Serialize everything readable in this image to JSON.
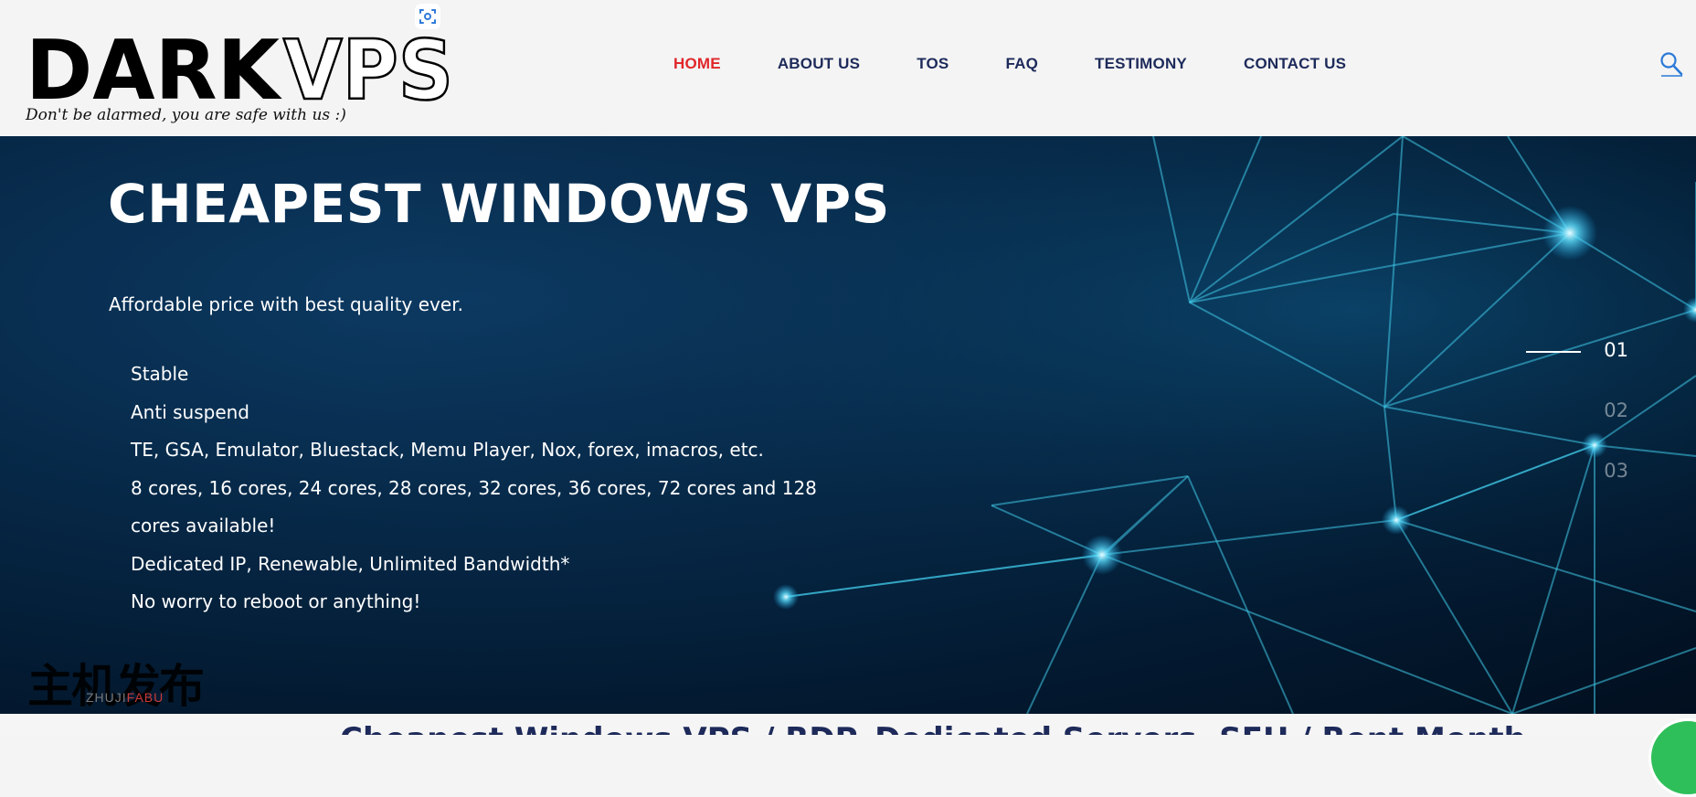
{
  "header": {
    "logo": {
      "word_dark": "DARK",
      "word_vps": "VPS",
      "tagline": "Don't be alarmed, you are safe with us :)"
    },
    "nav": [
      {
        "label": "HOME",
        "active": true
      },
      {
        "label": "ABOUT US"
      },
      {
        "label": "TOS"
      },
      {
        "label": "FAQ"
      },
      {
        "label": "TESTIMONY"
      },
      {
        "label": "CONTACT US"
      }
    ],
    "search_icon": "search-icon",
    "scan_icon": "screenshot-scan-icon"
  },
  "hero": {
    "title": "CHEAPEST WINDOWS VPS",
    "subtitle": "Affordable price with best quality ever.",
    "features": [
      "Stable",
      "Anti suspend",
      "TE, GSA, Emulator, Bluestack, Memu Player, Nox, forex, imacros, etc.",
      "8 cores, 16 cores, 24 cores, 28 cores, 32 cores, 36 cores, 72 cores and 128 cores available!",
      "Dedicated IP, Renewable, Unlimited Bandwidth*",
      "No worry to reboot or anything!"
    ],
    "slides": [
      "01",
      "02",
      "03"
    ],
    "active_slide": "01"
  },
  "watermark": {
    "cn": "主机发布",
    "en_part1": "ZHUJI",
    "en_part2": "FABU"
  },
  "bottom": {
    "heading": "Cheapest Windows VPS / RDP, Dedicated Servers, SEH / Rent Month"
  },
  "colors": {
    "nav_text": "#1d2a5a",
    "nav_active": "#e0272b",
    "hero_dark": "#031a31",
    "accent_cyan": "#3fd0ff",
    "chat_green": "#2fbf5a"
  }
}
